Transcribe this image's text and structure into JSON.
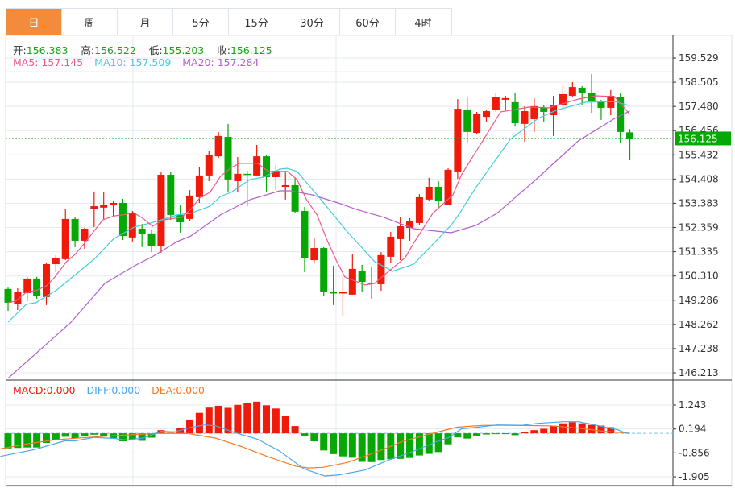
{
  "tabs": [
    {
      "label": "日",
      "active": true
    },
    {
      "label": "周"
    },
    {
      "label": "月"
    },
    {
      "label": "5分"
    },
    {
      "label": "15分"
    },
    {
      "label": "30分"
    },
    {
      "label": "60分"
    },
    {
      "label": "4时"
    }
  ],
  "ohlc": {
    "open_label": "开:",
    "open": "156.383",
    "high_label": "高:",
    "high": "156.522",
    "low_label": "低:",
    "low": "155.203",
    "close_label": "收:",
    "close": "156.125"
  },
  "ma_legend": {
    "ma5": "MA5: 157.145",
    "ma10": "MA10: 157.509",
    "ma20": "MA20: 157.284"
  },
  "macd_legend": {
    "macd": "MACD:0.000",
    "diff": "DIFF:0.000",
    "dea": "DEA:0.000"
  },
  "colors": {
    "up": "#f01a0a",
    "down": "#06a806",
    "ma5": "#f0588c",
    "ma10": "#40cde0",
    "ma20": "#b25ed0",
    "diff": "#4aa6f0",
    "dea": "#f57a22",
    "tab_active": "#f28c3c",
    "grid": "#e3eaf0"
  },
  "chart_data": [
    {
      "type": "candlestick",
      "ylim": [
        146.213,
        159.529
      ],
      "yticks": [
        "159.529",
        "158.505",
        "157.480",
        "156.456",
        "155.432",
        "154.408",
        "153.383",
        "152.359",
        "151.335",
        "150.310",
        "149.286",
        "148.262",
        "147.238",
        "146.213"
      ],
      "last_price": "156.125",
      "ohlc": [
        [
          149.76,
          149.82,
          148.84,
          149.18
        ],
        [
          149.14,
          149.79,
          148.87,
          149.62
        ],
        [
          149.59,
          150.27,
          149.25,
          150.2
        ],
        [
          150.2,
          150.27,
          149.35,
          149.48
        ],
        [
          149.42,
          150.88,
          149.08,
          150.81
        ],
        [
          150.81,
          151.19,
          150.47,
          151.05
        ],
        [
          151.02,
          153.16,
          150.98,
          152.72
        ],
        [
          152.72,
          152.82,
          151.53,
          151.8
        ],
        [
          151.8,
          152.34,
          151.46,
          152.31
        ],
        [
          153.13,
          153.88,
          152.38,
          153.26
        ],
        [
          153.2,
          153.84,
          152.72,
          153.33
        ],
        [
          153.3,
          153.47,
          152.79,
          153.4
        ],
        [
          153.4,
          153.57,
          151.83,
          152.0
        ],
        [
          151.94,
          153.06,
          151.77,
          152.96
        ],
        [
          152.31,
          152.51,
          151.53,
          152.07
        ],
        [
          152.11,
          152.28,
          151.32,
          151.56
        ],
        [
          151.56,
          154.69,
          151.29,
          154.59
        ],
        [
          154.59,
          154.69,
          152.68,
          152.89
        ],
        [
          152.89,
          153.33,
          152.14,
          152.58
        ],
        [
          152.72,
          153.94,
          152.62,
          153.71
        ],
        [
          153.64,
          154.9,
          153.4,
          154.56
        ],
        [
          154.56,
          155.61,
          154.32,
          155.44
        ],
        [
          155.37,
          156.4,
          155.31,
          156.23
        ],
        [
          156.19,
          156.74,
          153.84,
          154.39
        ],
        [
          154.32,
          155.34,
          153.84,
          154.63
        ],
        [
          154.63,
          154.76,
          153.26,
          154.59
        ],
        [
          154.56,
          155.85,
          154.52,
          155.37
        ],
        [
          155.37,
          155.41,
          153.88,
          154.49
        ],
        [
          154.49,
          155.0,
          153.94,
          154.76
        ],
        [
          154.08,
          154.69,
          153.54,
          154.15
        ],
        [
          154.15,
          154.46,
          152.99,
          153.03
        ],
        [
          153.06,
          153.23,
          150.47,
          151.05
        ],
        [
          150.98,
          151.94,
          150.88,
          151.49
        ],
        [
          151.49,
          151.53,
          149.48,
          149.62
        ],
        [
          149.62,
          150.74,
          149.08,
          149.59
        ],
        [
          149.59,
          150.27,
          148.63,
          149.62
        ],
        [
          149.52,
          151.22,
          149.52,
          150.61
        ],
        [
          150.51,
          150.78,
          149.65,
          150.06
        ],
        [
          149.99,
          150.68,
          149.35,
          150.03
        ],
        [
          149.96,
          151.32,
          149.69,
          151.19
        ],
        [
          151.12,
          152.17,
          150.88,
          151.97
        ],
        [
          151.87,
          152.82,
          150.98,
          152.41
        ],
        [
          152.34,
          152.75,
          151.8,
          152.62
        ],
        [
          152.55,
          153.77,
          152.48,
          153.64
        ],
        [
          153.54,
          154.46,
          153.47,
          154.08
        ],
        [
          154.08,
          154.32,
          153.16,
          153.47
        ],
        [
          153.33,
          154.86,
          153.33,
          154.8
        ],
        [
          154.73,
          157.79,
          154.42,
          157.38
        ],
        [
          157.35,
          157.89,
          155.92,
          156.4
        ],
        [
          156.36,
          157.25,
          156.29,
          157.15
        ],
        [
          157.04,
          157.35,
          156.84,
          157.28
        ],
        [
          157.35,
          158.06,
          157.25,
          157.89
        ],
        [
          157.76,
          157.93,
          157.32,
          157.83
        ],
        [
          157.66,
          158.03,
          156.63,
          156.77
        ],
        [
          156.74,
          157.49,
          155.99,
          157.28
        ],
        [
          156.94,
          157.83,
          156.4,
          157.49
        ],
        [
          157.42,
          157.52,
          156.84,
          157.25
        ],
        [
          157.11,
          157.93,
          156.23,
          157.55
        ],
        [
          157.52,
          158.41,
          157.35,
          158.0
        ],
        [
          157.93,
          158.51,
          157.86,
          158.3
        ],
        [
          158.27,
          158.34,
          157.55,
          158.03
        ],
        [
          158.06,
          158.85,
          157.21,
          157.69
        ],
        [
          157.66,
          157.76,
          156.91,
          157.42
        ],
        [
          157.42,
          158.17,
          157.11,
          157.93
        ],
        [
          157.89,
          158.03,
          155.92,
          156.4
        ],
        [
          156.383,
          156.522,
          155.203,
          156.125
        ]
      ],
      "ma5": [
        [
          1,
          149.18
        ],
        [
          1.8,
          149.25
        ],
        [
          2.9,
          149.62
        ],
        [
          3.9,
          149.69
        ],
        [
          5,
          149.89
        ],
        [
          5.9,
          150.27
        ],
        [
          7.1,
          150.91
        ],
        [
          8,
          151.22
        ],
        [
          9,
          151.7
        ],
        [
          10.9,
          152.68
        ],
        [
          12.1,
          152.85
        ],
        [
          13,
          152.89
        ],
        [
          14.1,
          152.99
        ],
        [
          15.1,
          152.75
        ],
        [
          16.1,
          152.41
        ],
        [
          17.2,
          152.68
        ],
        [
          19.1,
          152.79
        ],
        [
          20.1,
          153.13
        ],
        [
          21.1,
          153.64
        ],
        [
          22.1,
          153.84
        ],
        [
          23.2,
          154.52
        ],
        [
          24.2,
          154.86
        ],
        [
          25.2,
          155.07
        ],
        [
          27.1,
          155.07
        ],
        [
          28.2,
          154.73
        ],
        [
          30.2,
          154.73
        ],
        [
          31.2,
          154.39
        ],
        [
          32.2,
          153.54
        ],
        [
          33.3,
          152.89
        ],
        [
          34.3,
          151.87
        ],
        [
          35.3,
          150.98
        ],
        [
          36.2,
          150.27
        ],
        [
          38.3,
          149.93
        ],
        [
          39.3,
          149.99
        ],
        [
          40.3,
          150.34
        ],
        [
          42.5,
          151.08
        ],
        [
          43.4,
          151.7
        ],
        [
          45.4,
          152.96
        ],
        [
          47.5,
          153.74
        ],
        [
          48.4,
          154.59
        ],
        [
          50.5,
          155.95
        ],
        [
          52.5,
          157.25
        ],
        [
          55.5,
          157.45
        ],
        [
          57.5,
          157.42
        ],
        [
          60.6,
          157.79
        ],
        [
          62.5,
          157.93
        ],
        [
          64.4,
          157.89
        ],
        [
          66,
          157.145
        ]
      ],
      "ma10": [
        [
          1,
          148.36
        ],
        [
          2.9,
          149.11
        ],
        [
          3.9,
          149.18
        ],
        [
          6.1,
          149.72
        ],
        [
          10,
          151.02
        ],
        [
          12,
          151.87
        ],
        [
          14.2,
          152.38
        ],
        [
          16.2,
          152.58
        ],
        [
          18.7,
          152.89
        ],
        [
          20.1,
          152.96
        ],
        [
          22.1,
          153.26
        ],
        [
          23.2,
          153.67
        ],
        [
          24.3,
          153.84
        ],
        [
          26.3,
          154.39
        ],
        [
          27.7,
          154.49
        ],
        [
          29.4,
          154.83
        ],
        [
          30.2,
          154.86
        ],
        [
          31.2,
          154.73
        ],
        [
          33.3,
          153.74
        ],
        [
          36.4,
          152.21
        ],
        [
          39.3,
          150.92
        ],
        [
          41.2,
          150.51
        ],
        [
          43.4,
          150.81
        ],
        [
          47.3,
          152.45
        ],
        [
          48.2,
          152.96
        ],
        [
          49.9,
          154.05
        ],
        [
          53.5,
          156.09
        ],
        [
          56.4,
          156.97
        ],
        [
          58.3,
          157.32
        ],
        [
          61.4,
          157.66
        ],
        [
          64.4,
          157.69
        ],
        [
          66,
          157.509
        ]
      ],
      "ma20": [
        [
          1,
          145.98
        ],
        [
          7.6,
          148.36
        ],
        [
          11.1,
          149.99
        ],
        [
          14.2,
          150.74
        ],
        [
          16.2,
          151.15
        ],
        [
          18.7,
          151.77
        ],
        [
          20.1,
          152.0
        ],
        [
          23.2,
          152.89
        ],
        [
          26.3,
          153.54
        ],
        [
          29.4,
          153.91
        ],
        [
          30.5,
          153.91
        ],
        [
          32.8,
          153.74
        ],
        [
          35.5,
          153.4
        ],
        [
          37.4,
          153.13
        ],
        [
          40.3,
          152.79
        ],
        [
          43.4,
          152.31
        ],
        [
          47.3,
          152.14
        ],
        [
          49.9,
          152.45
        ],
        [
          52.1,
          152.96
        ],
        [
          56,
          154.32
        ],
        [
          60.6,
          156.02
        ],
        [
          64.4,
          156.97
        ],
        [
          66,
          157.284
        ]
      ]
    },
    {
      "type": "bar+line",
      "ylim": [
        -1.905,
        1.243
      ],
      "yticks": [
        "1.243",
        "0.194",
        "-0.856",
        "-1.905"
      ],
      "macd": [
        -0.66,
        -0.64,
        -0.62,
        -0.62,
        -0.42,
        -0.29,
        -0.15,
        -0.21,
        -0.12,
        -0.06,
        -0.12,
        -0.21,
        -0.35,
        -0.26,
        -0.33,
        -0.19,
        0.14,
        0.03,
        0.23,
        0.61,
        0.9,
        1.13,
        1.21,
        1.12,
        1.25,
        1.33,
        1.39,
        1.23,
        1.09,
        0.76,
        0.32,
        -0.12,
        -0.35,
        -0.75,
        -0.91,
        -1.01,
        -1.07,
        -1.25,
        -1.26,
        -1.17,
        -1.13,
        -1.12,
        -1.08,
        -0.97,
        -0.9,
        -0.82,
        -0.48,
        -0.18,
        -0.23,
        -0.11,
        -0.05,
        -0.01,
        -0.03,
        -0.08,
        0.05,
        0.14,
        0.2,
        0.33,
        0.44,
        0.49,
        0.44,
        0.37,
        0.34,
        0.27,
        0,
        0
      ],
      "diff": [
        [
          0.2,
          -1.01
        ],
        [
          3.8,
          -0.71
        ],
        [
          6.9,
          -0.33
        ],
        [
          8,
          -0.33
        ],
        [
          10,
          -0.18
        ],
        [
          12,
          -0.22
        ],
        [
          13.4,
          -0.29
        ],
        [
          15.1,
          -0.21
        ],
        [
          17,
          0.09
        ],
        [
          18.4,
          0.06
        ],
        [
          19.8,
          0.23
        ],
        [
          21.5,
          0.37
        ],
        [
          22.7,
          0.33
        ],
        [
          24.8,
          0.02
        ],
        [
          27.1,
          -0.26
        ],
        [
          29.4,
          -0.78
        ],
        [
          31.9,
          -1.55
        ],
        [
          34.1,
          -1.87
        ],
        [
          35.5,
          -1.83
        ],
        [
          38.3,
          -1.61
        ],
        [
          40.8,
          -1.17
        ],
        [
          43.4,
          -0.78
        ],
        [
          45.9,
          -0.35
        ],
        [
          47.1,
          -0.18
        ],
        [
          48.4,
          0.2
        ],
        [
          50.1,
          0.27
        ],
        [
          52.1,
          0.37
        ],
        [
          54.7,
          0.35
        ],
        [
          56.4,
          0.44
        ],
        [
          59.1,
          0.51
        ],
        [
          60.6,
          0.51
        ],
        [
          61.9,
          0.41
        ],
        [
          64.8,
          0.15
        ],
        [
          65.5,
          0.02
        ],
        [
          66,
          0
        ]
      ],
      "dea": [
        [
          0.2,
          -0.68
        ],
        [
          2.9,
          -0.47
        ],
        [
          5.8,
          -0.29
        ],
        [
          8.6,
          -0.2
        ],
        [
          11.4,
          -0.12
        ],
        [
          14.2,
          -0.05
        ],
        [
          17,
          0
        ],
        [
          19.8,
          -0.01
        ],
        [
          22.7,
          -0.21
        ],
        [
          25.4,
          -0.58
        ],
        [
          28.2,
          -1.03
        ],
        [
          31.1,
          -1.45
        ],
        [
          32.4,
          -1.52
        ],
        [
          33.9,
          -1.49
        ],
        [
          35.3,
          -1.38
        ],
        [
          36.6,
          -1.26
        ],
        [
          39.5,
          -0.82
        ],
        [
          42.3,
          -0.35
        ],
        [
          45.1,
          -0.03
        ],
        [
          47.9,
          0.27
        ],
        [
          50.7,
          0.35
        ],
        [
          53.5,
          0.35
        ],
        [
          57.7,
          0.33
        ],
        [
          60.6,
          0.23
        ],
        [
          63.3,
          0.09
        ],
        [
          66,
          0
        ]
      ]
    }
  ]
}
